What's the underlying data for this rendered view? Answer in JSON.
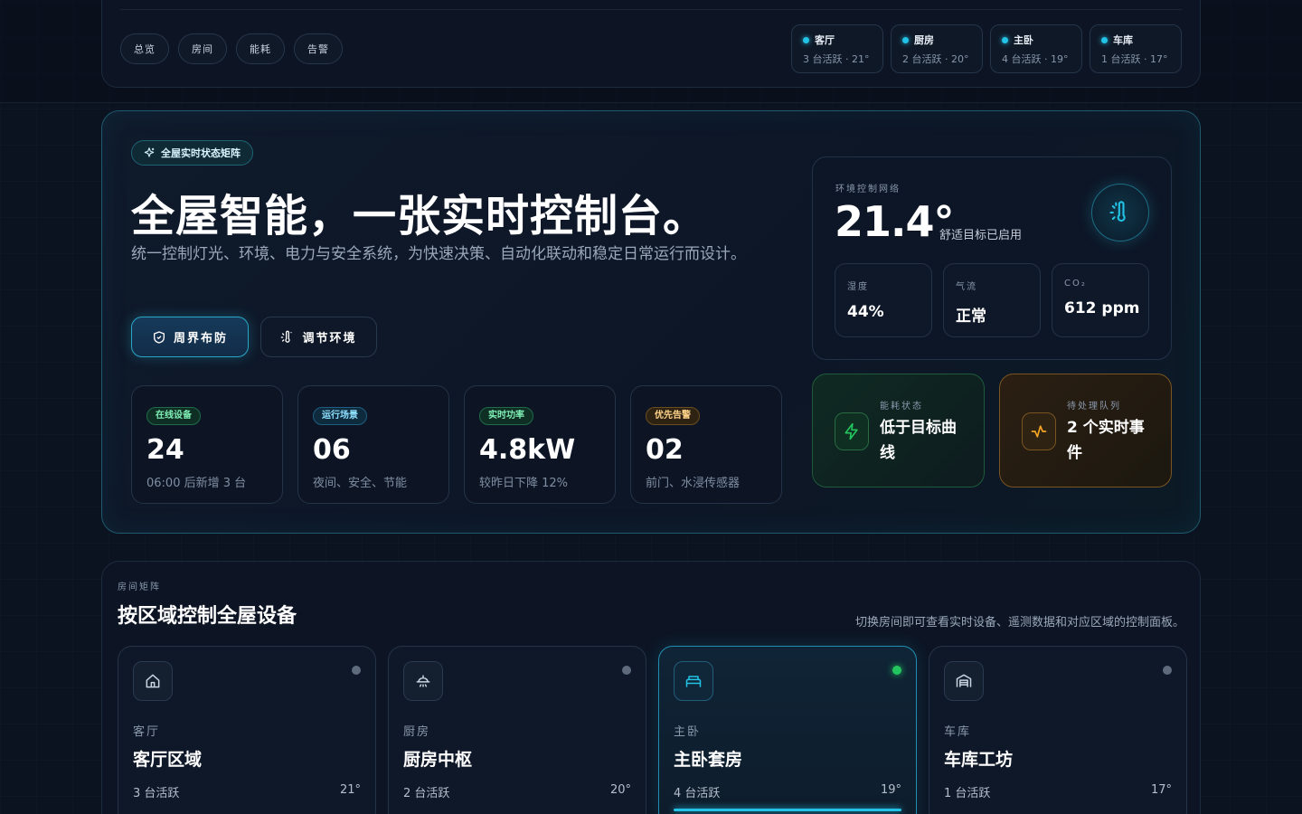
{
  "nav": {
    "tabs": [
      "总览",
      "房间",
      "能耗",
      "告警"
    ],
    "rooms": [
      {
        "name": "客厅",
        "sub": "3 台活跃 · 21°"
      },
      {
        "name": "厨房",
        "sub": "2 台活跃 · 20°"
      },
      {
        "name": "主卧",
        "sub": "4 台活跃 · 19°"
      },
      {
        "name": "车库",
        "sub": "1 台活跃 · 17°"
      }
    ]
  },
  "hero": {
    "badge": "全屋实时状态矩阵",
    "title": "全屋智能，一张实时控制台。",
    "description": "统一控制灯光、环境、电力与安全系统，为快速决策、自动化联动和稳定日常运行而设计。",
    "primary_button": "周界布防",
    "secondary_button": "调节环境",
    "stats": [
      {
        "tag": "在线设备",
        "value": "24",
        "note": "06:00 后新增 3 台"
      },
      {
        "tag": "运行场景",
        "value": "06",
        "note": "夜间、安全、节能"
      },
      {
        "tag": "实时功率",
        "value": "4.8kW",
        "note": "较昨日下降 12%"
      },
      {
        "tag": "优先告警",
        "value": "02",
        "note": "前门、水浸传感器"
      }
    ]
  },
  "environment": {
    "label": "环境控制网络",
    "temperature": "21.4°",
    "target": "舒适目标已启用",
    "metrics": [
      {
        "label": "湿度",
        "value": "44%"
      },
      {
        "label": "气流",
        "value": "正常"
      },
      {
        "label": "CO₂",
        "value": "612 ppm"
      }
    ]
  },
  "status": {
    "energy": {
      "label": "能耗状态",
      "value": "低于目标曲线"
    },
    "queue": {
      "label": "待处理队列",
      "value": "2 个实时事件"
    }
  },
  "rooms": {
    "eyebrow": "房间矩阵",
    "title": "按区域控制全屋设备",
    "hint": "切换房间即可查看实时设备、遥测数据和对应区域的控制面板。",
    "cards": [
      {
        "category": "客厅",
        "name": "客厅区域",
        "active": "3 台活跃",
        "temp": "21°"
      },
      {
        "category": "厨房",
        "name": "厨房中枢",
        "active": "2 台活跃",
        "temp": "20°"
      },
      {
        "category": "主卧",
        "name": "主卧套房",
        "active": "4 台活跃",
        "temp": "19°"
      },
      {
        "category": "车库",
        "name": "车库工坊",
        "active": "1 台活跃",
        "temp": "17°"
      }
    ]
  },
  "colors": {
    "accent": "#22c3e6",
    "success": "#22c55e",
    "warning": "#f5a524",
    "background": "#0b1220"
  }
}
